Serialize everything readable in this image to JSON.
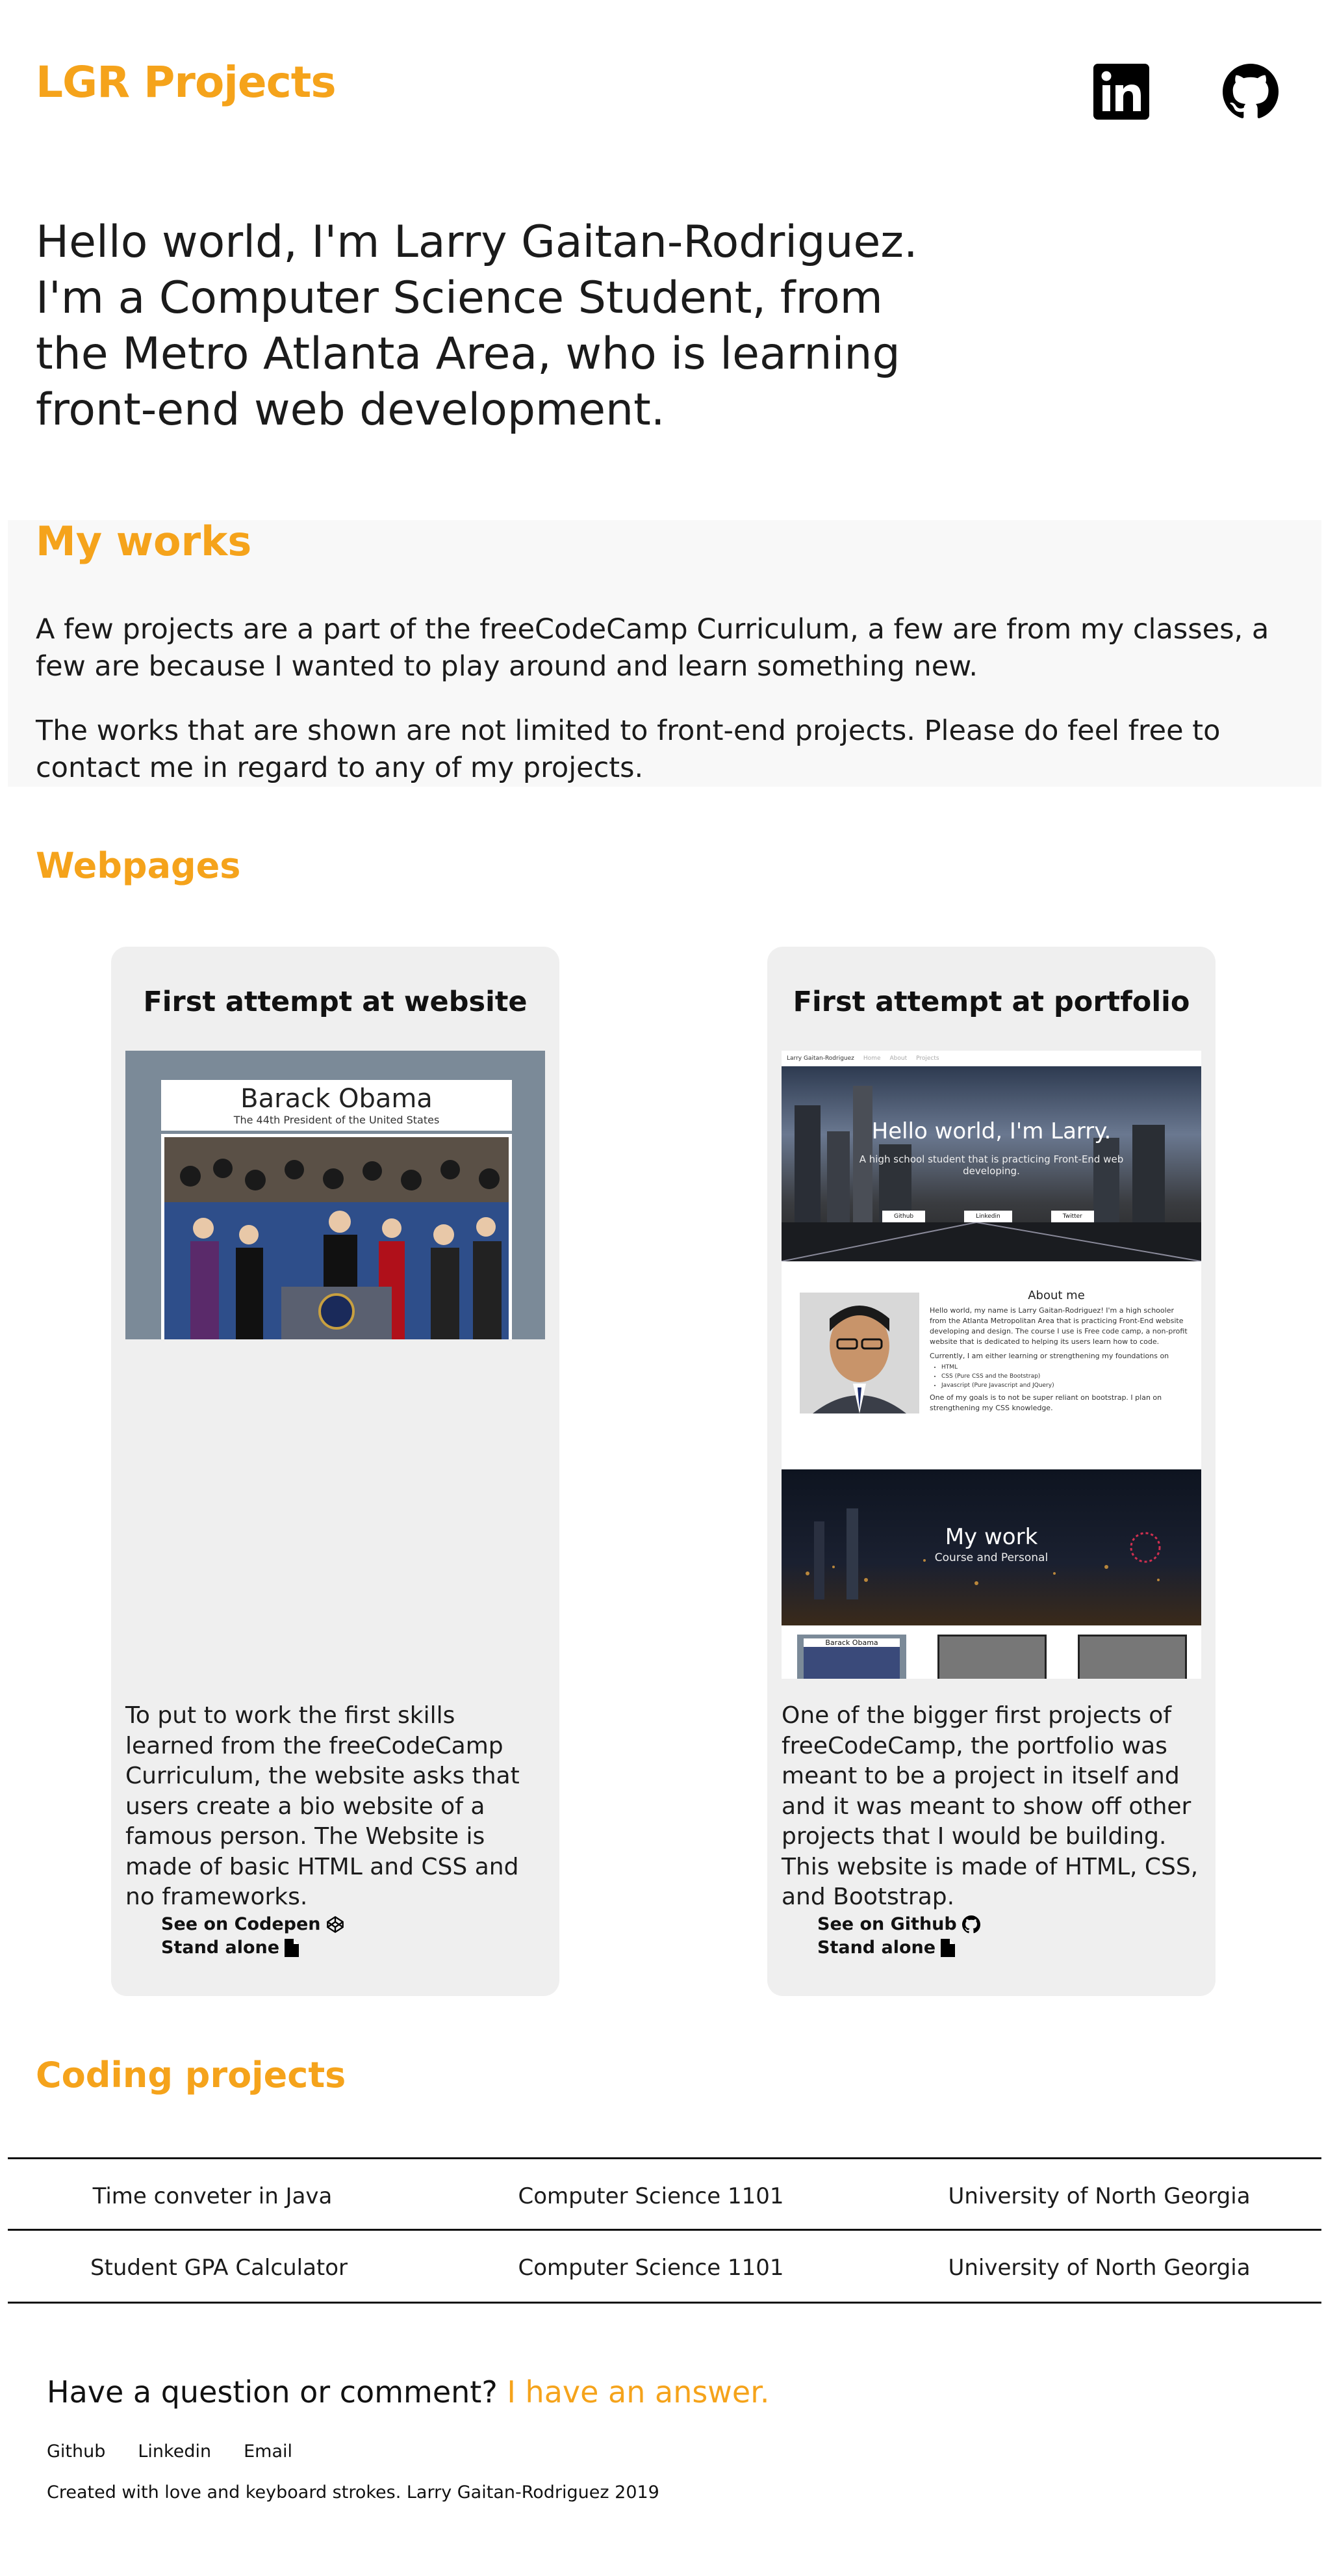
{
  "header": {
    "brand": "LGR Projects",
    "social": [
      {
        "name": "linkedin",
        "icon": "linkedin-icon"
      },
      {
        "name": "github",
        "icon": "github-icon"
      }
    ]
  },
  "intro": "Hello world, I'm Larry Gaitan-Rodriguez. I'm a Computer Science Student, from the Metro Atlanta Area, who is learning front-end web development.",
  "works": {
    "title": "My works",
    "p1": "A few projects are a part of the freeCodeCamp Curriculum, a few are from my classes, a few are because I wanted to play around and learn something new.",
    "p2": "The works that are shown are not limited to front-end projects. Please do feel free to contact me in regard to any of my projects."
  },
  "webpages": {
    "title": "Webpages",
    "cards": [
      {
        "title": "First attempt at website",
        "description": "To put to work the first skills learned from the freeCodeCamp Curriculum, the website asks that users create a bio website of a famous person. The Website is made of basic HTML and CSS and no frameworks.",
        "link1": "See on Codepen",
        "link1_icon": "codepen-icon",
        "link2": "Stand alone",
        "link2_icon": "file-icon",
        "preview": {
          "heading": "Barack Obama",
          "subheading": "The 44th President of the United States"
        }
      },
      {
        "title": "First attempt at portfolio",
        "description": "One of the bigger first projects of freeCodeCamp, the portfolio was meant to be a project in itself and and it was meant to show off other projects that I would be building. This website is made of HTML, CSS, and Bootstrap.",
        "link1": "See on Github",
        "link1_icon": "github-icon",
        "link2": "Stand alone",
        "link2_icon": "file-icon",
        "preview": {
          "nav_brand": "Larry Gaitan-Rodriguez",
          "nav_links": [
            "Home",
            "About",
            "Projects"
          ],
          "hero_title": "Hello world, I'm Larry.",
          "hero_sub": "A high school student that is practicing Front-End web developing.",
          "hero_buttons": [
            "Github",
            "Linkedin",
            "Twitter"
          ],
          "about_title": "About me",
          "about_p1": "Hello world, my name is Larry Gaitan-Rodriguez! I'm a high schooler from the Atlanta Metropolitan Area that is practicing Front-End website developing and design. The course I use is Free code camp, a non-profit website that is dedicated to helping its users learn how to code.",
          "about_p2": "Currently, I am either learning or strengthening my foundations on",
          "about_list": [
            "HTML",
            "CSS (Pure CSS and the Bootstrap)",
            "Javascript (Pure Javascript and JQuery)"
          ],
          "about_p3": "One of my goals is to not be super reliant on bootstrap. I plan on strengthening my CSS knowledge.",
          "work_title": "My work",
          "work_sub": "Course and Personal",
          "thumb_label": "Barack Obama"
        }
      }
    ]
  },
  "coding": {
    "title": "Coding projects",
    "rows": [
      [
        "Time conveter in Java",
        "Computer Science 1101",
        "University of North Georgia"
      ],
      [
        "Student GPA Calculator",
        "Computer Science 1101",
        "University of North Georgia"
      ]
    ]
  },
  "footer": {
    "question": "Have a question or comment?",
    "answer": "I have an answer.",
    "links": [
      "Github",
      "Linkedin",
      "Email"
    ],
    "credit": "Created with love and keyboard strokes. Larry Gaitan-Rodriguez 2019"
  },
  "colors": {
    "accent": "#f5a31b",
    "card_bg": "#efefef",
    "section_bg": "#f8f8f8"
  }
}
